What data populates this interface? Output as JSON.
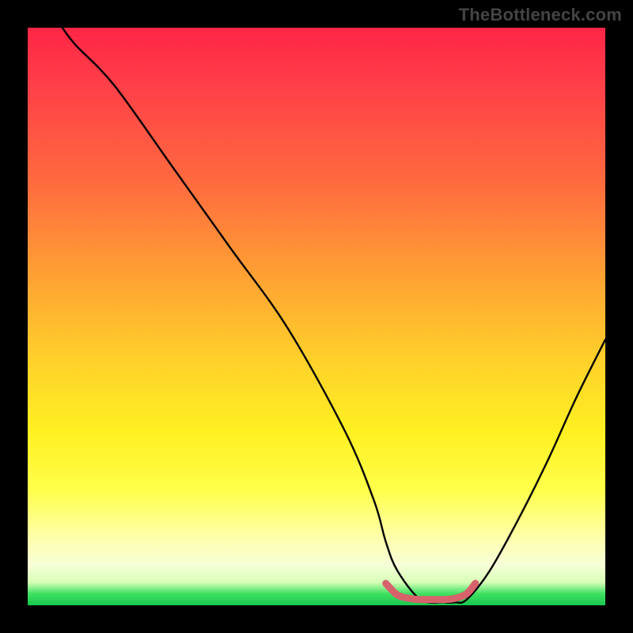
{
  "watermark": "TheBottleneck.com",
  "colors": {
    "background": "#000000",
    "gradient_top": "#ff2546",
    "gradient_mid1": "#ff6e3e",
    "gradient_mid2": "#ffd22a",
    "gradient_mid3": "#ffff4a",
    "gradient_bottom": "#18c850",
    "curve": "#000000",
    "highlight": "#d6636b"
  },
  "chart_data": {
    "type": "line",
    "title": "",
    "xlabel": "",
    "ylabel": "",
    "xlim": [
      0,
      100
    ],
    "ylim": [
      0,
      100
    ],
    "series": [
      {
        "name": "curve",
        "x": [
          6,
          8.3,
          15,
          25,
          35,
          45,
          55,
          60,
          62,
          64,
          68,
          72,
          74,
          76,
          80,
          85,
          90,
          95,
          100
        ],
        "y": [
          100,
          97,
          90,
          76,
          62,
          48,
          30,
          18,
          11,
          6,
          1,
          0.5,
          0.5,
          1,
          6,
          15,
          25,
          36,
          46
        ]
      },
      {
        "name": "highlight",
        "x": [
          62,
          64,
          66,
          68,
          70,
          72,
          74,
          76,
          77.5
        ],
        "y": [
          3.8,
          1.8,
          1.2,
          1.0,
          1.0,
          1.0,
          1.2,
          2.0,
          3.8
        ]
      }
    ]
  }
}
